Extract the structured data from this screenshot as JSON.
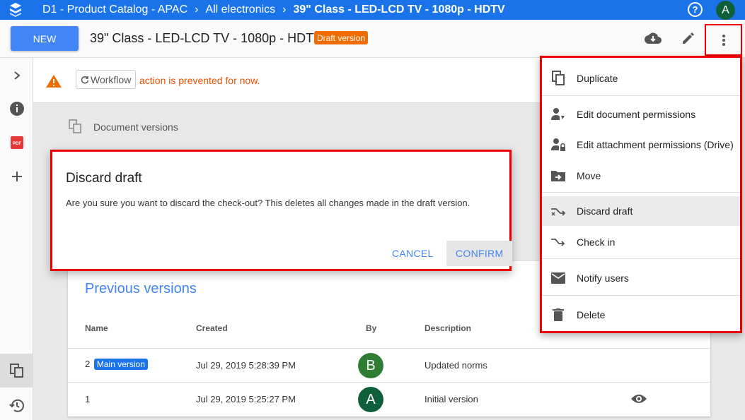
{
  "topbar": {
    "crumbs": [
      "D1 - Product Catalog - APAC",
      "All electronics",
      "39\" Class - LED-LCD TV - 1080p - HDTV"
    ],
    "help_label": "?",
    "avatar_letter": "A",
    "color": "#1a73e8"
  },
  "header": {
    "new_label": "NEW",
    "title": "39\" Class - LED-LCD TV - 1080p - HDTV",
    "draft_badge": "Draft version"
  },
  "warning": {
    "workflow_label": "Workflow",
    "text": "action is prevented for now."
  },
  "doc_versions_label": "Document versions",
  "dialog": {
    "title": "Discard draft",
    "body": "Are you sure you want to discard the check-out? This deletes all changes made in the draft version.",
    "cancel_label": "CANCEL",
    "confirm_label": "CONFIRM"
  },
  "previous_versions": {
    "title": "Previous versions",
    "columns": [
      "Name",
      "Created",
      "By",
      "Description"
    ],
    "rows": [
      {
        "name": "2",
        "badge": "Main version",
        "created": "Jul 29, 2019 5:28:39 PM",
        "by": "B",
        "by_color": "#2e7d32",
        "description": "Updated norms"
      },
      {
        "name": "1",
        "badge": "",
        "created": "Jul 29, 2019 5:25:27 PM",
        "by": "A",
        "by_color": "#0f5f3a",
        "description": "Initial version"
      }
    ]
  },
  "menu": {
    "items": [
      {
        "label": "Duplicate",
        "icon": "copy-icon"
      },
      {
        "label": "Edit document permissions",
        "icon": "person-edit-icon"
      },
      {
        "label": "Edit attachment permissions (Drive)",
        "icon": "person-lock-icon"
      },
      {
        "label": "Move",
        "icon": "folder-move-icon"
      },
      {
        "label": "Discard draft",
        "icon": "discard-icon"
      },
      {
        "label": "Check in",
        "icon": "check-in-icon"
      },
      {
        "label": "Notify users",
        "icon": "mail-icon"
      },
      {
        "label": "Delete",
        "icon": "trash-icon"
      }
    ]
  },
  "colors": {
    "accent": "#4285f4",
    "warning": "#e65100",
    "highlight_border": "#ee0000"
  }
}
